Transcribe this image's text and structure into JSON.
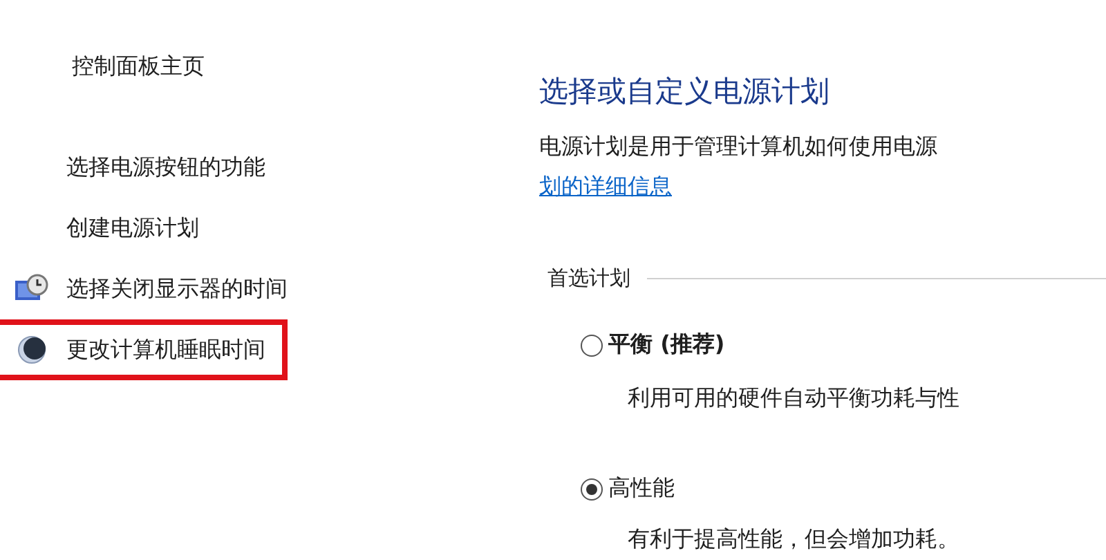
{
  "sidebar": {
    "home_link": "控制面板主页",
    "items": [
      {
        "label": "选择电源按钮的功能",
        "kind": "plain",
        "highlighted": false
      },
      {
        "label": "创建电源计划",
        "kind": "plain",
        "highlighted": false
      },
      {
        "label": "选择关闭显示器的时间",
        "kind": "monitor",
        "highlighted": false
      },
      {
        "label": "更改计算机睡眠时间",
        "kind": "sleep",
        "highlighted": true
      }
    ]
  },
  "main": {
    "title": "选择或自定义电源计划",
    "description": "电源计划是用于管理计算机如何使用电源",
    "link": "划的详细信息",
    "group_label": "首选计划",
    "plans": [
      {
        "name": "平衡 (推荐)",
        "description": "利用可用的硬件自动平衡功耗与性",
        "selected": false
      },
      {
        "name": "高性能",
        "description": "有利于提高性能，但会增加功耗。",
        "selected": true
      }
    ]
  }
}
